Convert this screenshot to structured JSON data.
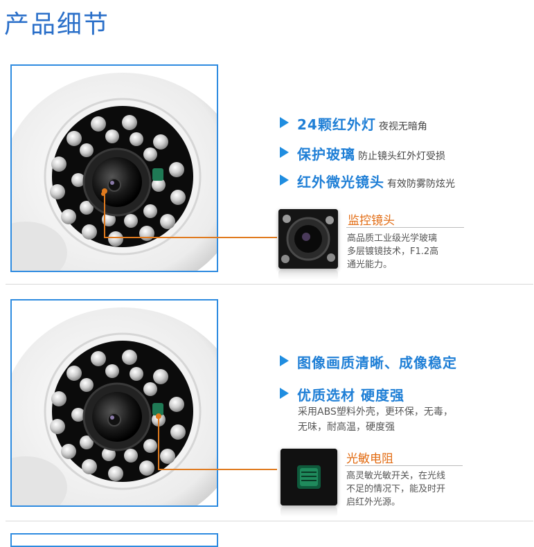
{
  "page_title": "产品细节",
  "section1": {
    "features": [
      {
        "title": "24颗红外灯",
        "subtitle": "夜视无暗角"
      },
      {
        "title": "保护玻璃",
        "subtitle": "防止镜头红外灯受损"
      },
      {
        "title": "红外微光镜头",
        "subtitle": "有效防雾防炫光"
      }
    ],
    "callout": {
      "title": "监控镜头",
      "lines": [
        "高品质工业级光学玻璃",
        "多层镀镜技术，F1.2高",
        "通光能力。"
      ]
    }
  },
  "section2": {
    "features": [
      {
        "title": "图像画质清晰、成像稳定",
        "subtitle": ""
      },
      {
        "title": "优质选材 硬度强",
        "subtitle": ""
      }
    ],
    "description_lines": [
      "采用ABS塑料外壳，更环保，无毒，",
      "无味，耐高温，硬度强"
    ],
    "callout": {
      "title": "光敏电阻",
      "lines": [
        "高灵敏光敏开关，在光线",
        "不足的情况下，能及时开",
        "启红外光源。"
      ]
    }
  },
  "colors": {
    "accent_blue": "#1f7fd6",
    "frame_blue": "#2e8be0",
    "callout_orange": "#e26b12"
  }
}
